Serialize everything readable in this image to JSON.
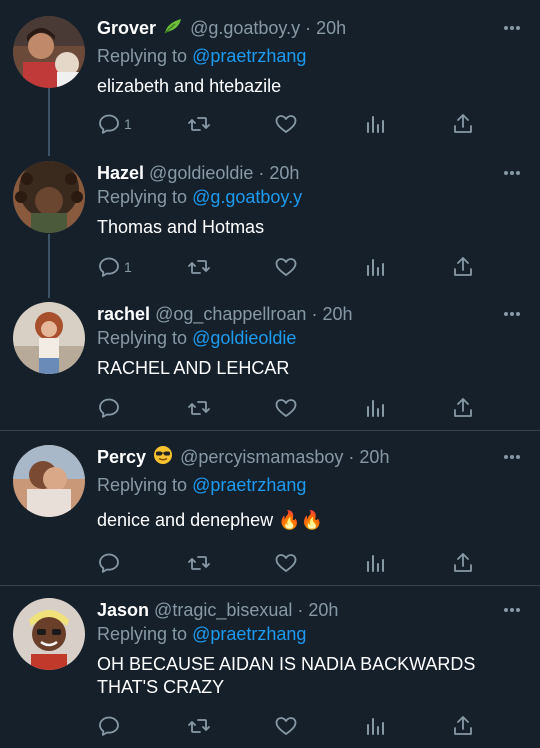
{
  "ui": {
    "replying_prefix": "Replying to ",
    "icon_color": "#8899a6",
    "mention_color": "#1d9bf0"
  },
  "tweets": [
    {
      "name": "Grover",
      "emoji": "leaf-icon",
      "handle": "@g.goatboy.y",
      "time": "· 20h",
      "replying_to": "@praetrzhang",
      "text": "elizabeth and htebazile",
      "reply_count": "1"
    },
    {
      "name": "Hazel",
      "handle": "@goldieoldie",
      "time": "· 20h",
      "replying_to": "@g.goatboy.y",
      "text": "Thomas and Hotmas",
      "reply_count": "1"
    },
    {
      "name": "rachel",
      "handle": "@og_chappellroan",
      "time": "· 20h",
      "replying_to": "@goldieoldie",
      "text": "RACHEL AND LEHCAR",
      "reply_count": ""
    },
    {
      "name": "Percy",
      "emoji": "sunglasses-face-icon",
      "handle": "@percyismamasboy",
      "time": "· 20h",
      "replying_to": "@praetrzhang",
      "text": "denice and denephew 🔥🔥",
      "reply_count": ""
    },
    {
      "name": "Jason",
      "handle": "@tragic_bisexual",
      "time": "· 20h",
      "replying_to": "@praetrzhang",
      "text": "OH BECAUSE AIDAN IS NADIA BACKWARDS THAT'S CRAZY",
      "reply_count": ""
    }
  ]
}
